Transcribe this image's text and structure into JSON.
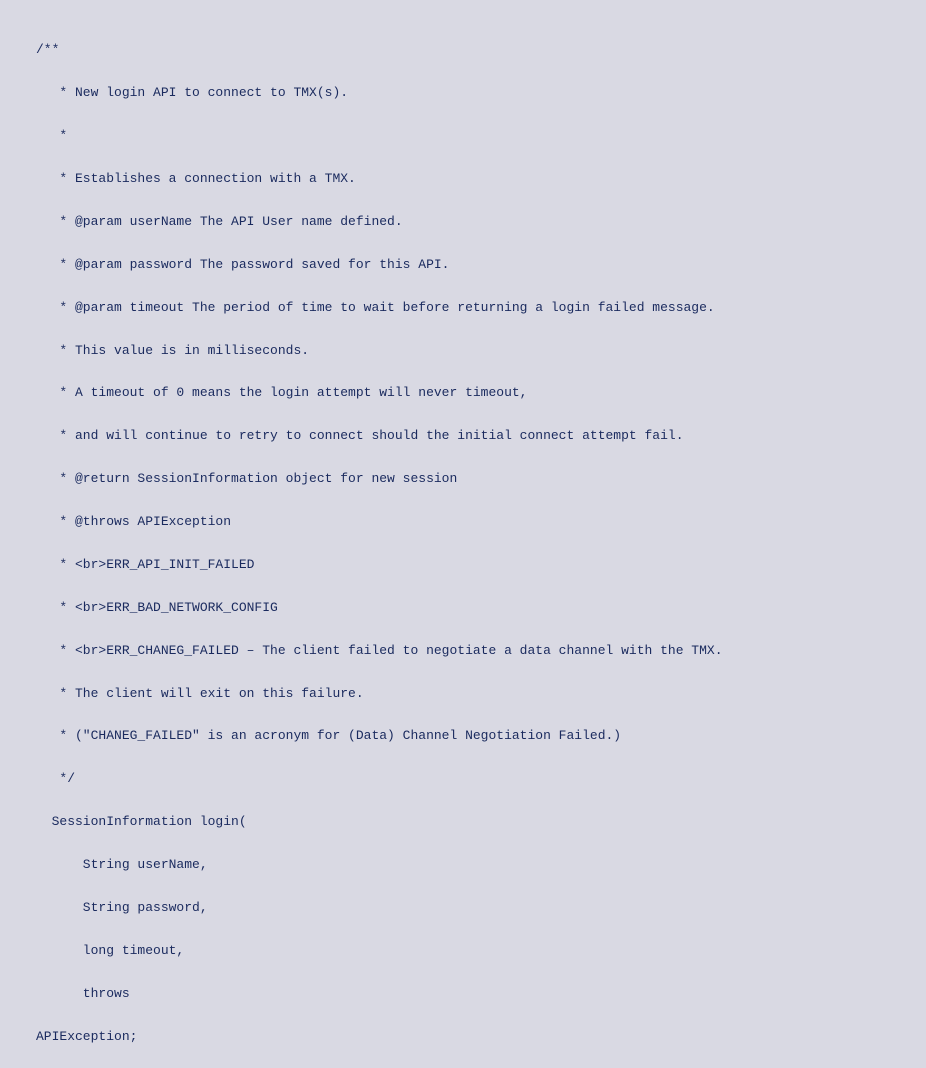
{
  "code": {
    "l0": "/**",
    "l1": "   * New login API to connect to TMX(s).",
    "l2": "   *",
    "l3": "   * Establishes a connection with a TMX.",
    "l4": "   * @param userName The API User name defined.",
    "l5": "   * @param password The password saved for this API.",
    "l6": "   * @param timeout The period of time to wait before returning a login failed message.",
    "l7": "   * This value is in milliseconds.",
    "l8": "   * A timeout of 0 means the login attempt will never timeout,",
    "l9": "   * and will continue to retry to connect should the initial connect attempt fail.",
    "l10": "   * @return SessionInformation object for new session",
    "l11": "   * @throws APIException",
    "l12": "   * <br>ERR_API_INIT_FAILED",
    "l13": "   * <br>ERR_BAD_NETWORK_CONFIG",
    "l14": "   * <br>ERR_CHANEG_FAILED – The client failed to negotiate a data channel with the TMX.",
    "l15": "   * The client will exit on this failure.",
    "l16": "   * (\"CHANEG_FAILED\" is an acronym for (Data) Channel Negotiation Failed.)",
    "l17": "   */",
    "l18": "  SessionInformation login(",
    "l19": "      String userName,",
    "l20": "      String password,",
    "l21": "      long timeout,",
    "l22": "      throws",
    "l23": "APIException;"
  }
}
